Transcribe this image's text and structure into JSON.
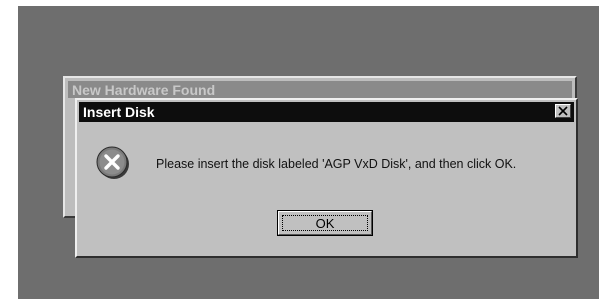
{
  "background_dialog": {
    "title": "New Hardware Found"
  },
  "dialog": {
    "title": "Insert Disk",
    "message": "Please insert the disk labeled 'AGP VxD Disk', and then click OK.",
    "icon": "error-icon",
    "ok_label": "OK",
    "close_icon": "close-icon"
  },
  "colors": {
    "desktop": "#6e6e6e",
    "dialog_face": "#c0c0c0",
    "titlebar_active": "#0d0d0d",
    "titlebar_inactive": "#8a8a8a"
  }
}
